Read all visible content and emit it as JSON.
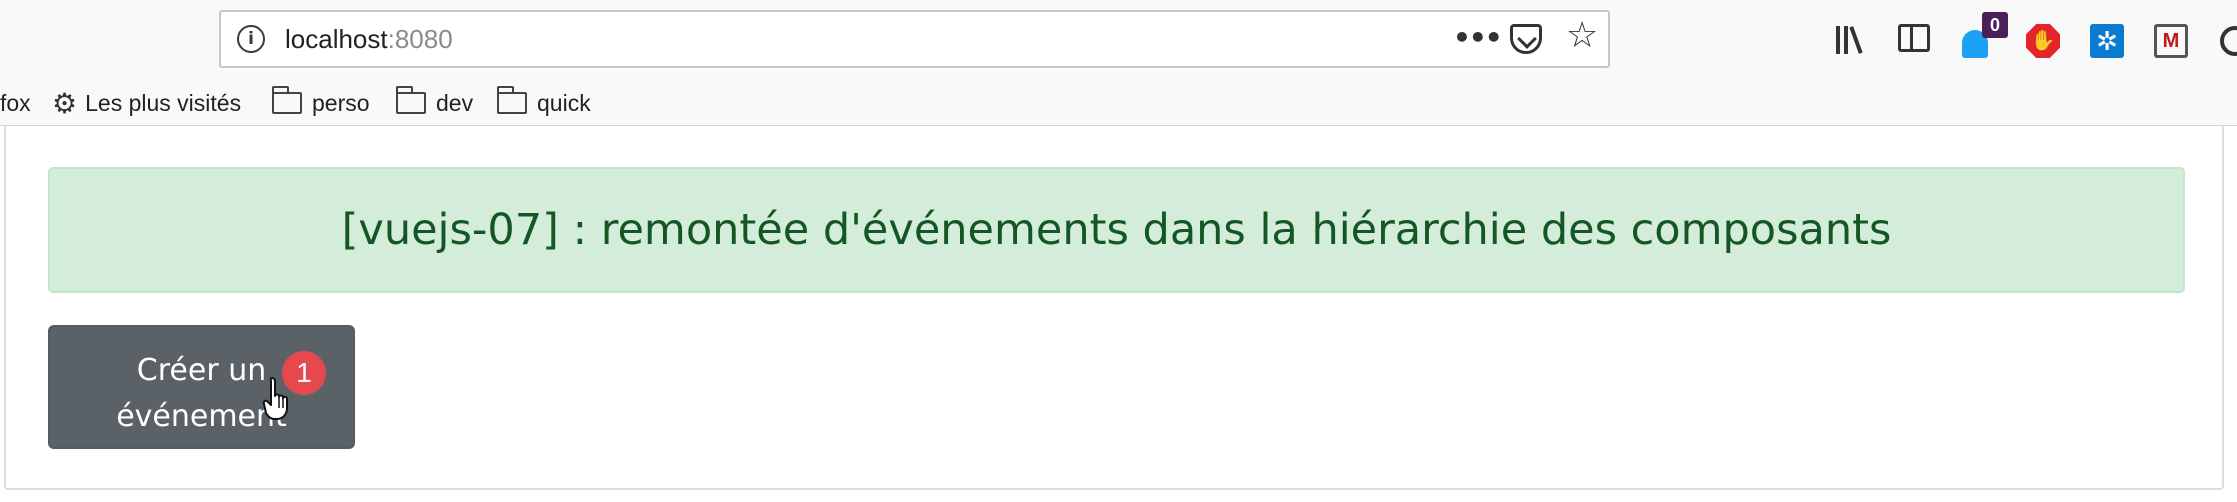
{
  "browser": {
    "url_host": "localhost",
    "url_port": ":8080",
    "page_actions_icon": "ellipsis-icon",
    "pocket_icon": "pocket-icon",
    "bookmark_star_icon": "star-icon",
    "ghostery_badge": "0",
    "bookmarks": {
      "partial_first": "fox",
      "most_visited": "Les plus visités",
      "folders": [
        "perso",
        "dev",
        "quick"
      ]
    }
  },
  "page": {
    "title": "[vuejs-07] : remontée d'événements dans la hiérarchie des composants",
    "create_button_label": "Créer un événement",
    "step_callout": "1"
  },
  "colors": {
    "alert_bg": "#d4edda",
    "alert_text": "#155724",
    "button_bg": "#5a6268",
    "callout": "#e5484d"
  }
}
